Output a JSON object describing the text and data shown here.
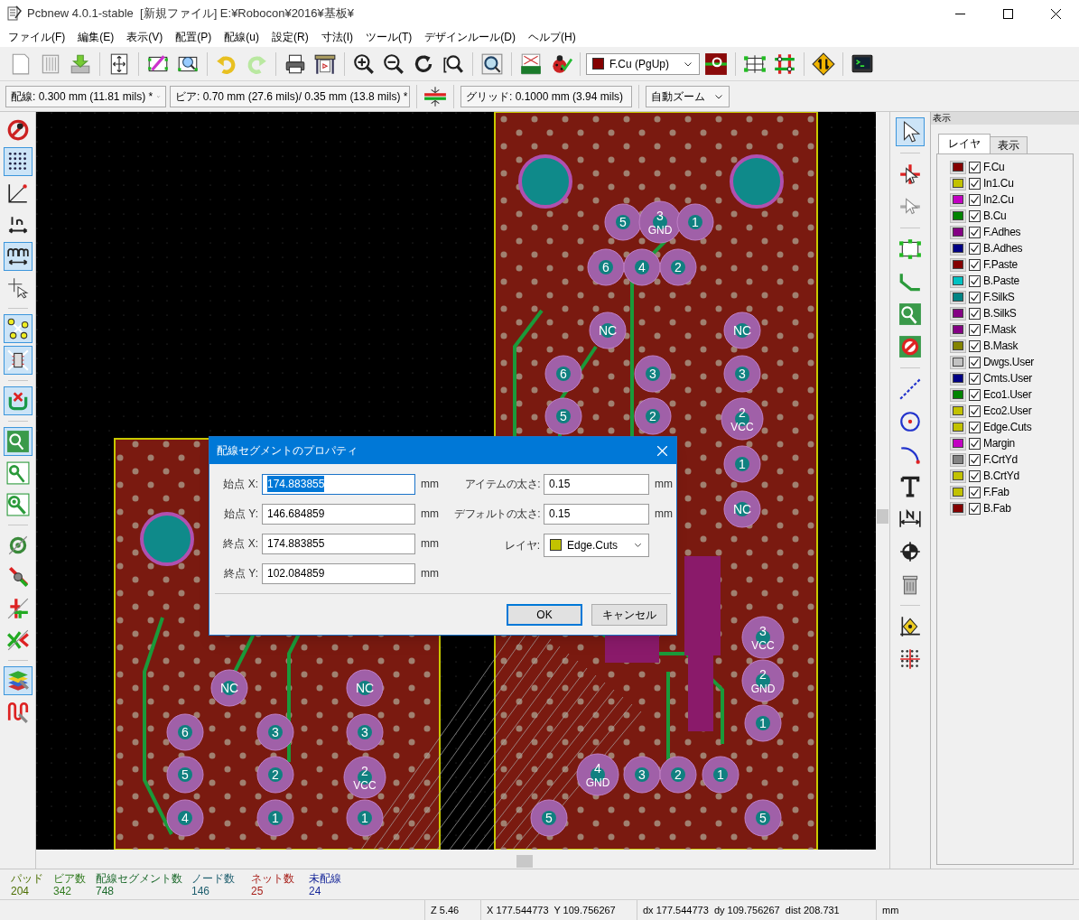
{
  "window": {
    "title": "Pcbnew 4.0.1-stable  [新規ファイル] E:¥Robocon¥2016¥基板¥"
  },
  "menu": [
    "ファイル(F)",
    "編集(E)",
    "表示(V)",
    "配置(P)",
    "配線(u)",
    "設定(R)",
    "寸法(I)",
    "ツール(T)",
    "デザインルール(D)",
    "ヘルプ(H)"
  ],
  "toolbar": {
    "layer_select": {
      "value": "F.Cu (PgUp)",
      "color": "#840000"
    }
  },
  "aux_toolbar": {
    "track_width": "配線: 0.300 mm (11.81 mils) *",
    "via_size": "ビア: 0.70 mm (27.6 mils)/ 0.35 mm (13.8 mils) *",
    "grid": "グリッド: 0.1000 mm (3.94 mils)",
    "zoom": "自動ズーム"
  },
  "left_toolbar": [
    {
      "on": false
    },
    {
      "on": true
    },
    {
      "on": false
    },
    {
      "on": false
    },
    {
      "on": true
    },
    {
      "on": false
    },
    {
      "on": true
    },
    {
      "on": true
    },
    {
      "on": true
    },
    {
      "on": true
    },
    {
      "on": false
    },
    {
      "on": false
    },
    {
      "on": false
    },
    {
      "on": false
    },
    {
      "on": false
    },
    {
      "on": false
    },
    {
      "on": true
    },
    {
      "on": false
    }
  ],
  "right_toolbar": [
    {
      "selected": true
    },
    {
      "selected": false
    },
    {
      "selected": false
    },
    {
      "selected": false
    },
    {
      "selected": false
    },
    {
      "selected": false
    },
    {
      "selected": false
    },
    {
      "selected": false
    },
    {
      "selected": false
    },
    {
      "selected": false
    },
    {
      "selected": false
    },
    {
      "selected": false
    },
    {
      "selected": false
    },
    {
      "selected": false
    },
    {
      "selected": false
    },
    {
      "selected": false
    }
  ],
  "canvas": {
    "pads": [
      {
        "number": "5"
      },
      {
        "number": "3",
        "net": "GND"
      },
      {
        "number": "1"
      },
      {
        "number": "6"
      },
      {
        "number": "4"
      },
      {
        "number": "2"
      },
      {
        "number": "NC"
      },
      {
        "number": "NC"
      },
      {
        "number": "6"
      },
      {
        "number": "3"
      },
      {
        "number": "3"
      },
      {
        "number": "5"
      },
      {
        "number": "2"
      },
      {
        "number": "2",
        "net": "VCC"
      },
      {
        "number": "1"
      },
      {
        "number": "NC"
      },
      {
        "number": "3",
        "net": "VCC"
      },
      {
        "number": "2",
        "net": "GND"
      },
      {
        "number": "1"
      },
      {
        "number": "4",
        "net": "GND"
      },
      {
        "number": "3"
      },
      {
        "number": "2"
      },
      {
        "number": "1"
      },
      {
        "number": "5"
      },
      {
        "number": "5"
      },
      {
        "number": "NC"
      },
      {
        "number": "NC"
      },
      {
        "number": "6"
      },
      {
        "number": "3"
      },
      {
        "number": "3"
      },
      {
        "number": "5"
      },
      {
        "number": "2"
      },
      {
        "number": "2",
        "net": "VCC"
      },
      {
        "number": "4"
      },
      {
        "number": "1"
      },
      {
        "number": "1"
      }
    ]
  },
  "layers_panel": {
    "title": "表示",
    "tabs": [
      {
        "label": "レイヤ",
        "selected": true
      },
      {
        "label": "表示",
        "selected": false
      }
    ],
    "layers": [
      {
        "name": "F.Cu",
        "color": "#840000",
        "checked": true
      },
      {
        "name": "In1.Cu",
        "color": "#c2c200",
        "checked": true
      },
      {
        "name": "In2.Cu",
        "color": "#c200c2",
        "checked": true
      },
      {
        "name": "B.Cu",
        "color": "#008400",
        "checked": true
      },
      {
        "name": "F.Adhes",
        "color": "#840084",
        "checked": true
      },
      {
        "name": "B.Adhes",
        "color": "#000084",
        "checked": true
      },
      {
        "name": "F.Paste",
        "color": "#840000",
        "checked": true
      },
      {
        "name": "B.Paste",
        "color": "#00c2c2",
        "checked": true
      },
      {
        "name": "F.SilkS",
        "color": "#008484",
        "checked": true
      },
      {
        "name": "B.SilkS",
        "color": "#840084",
        "checked": true
      },
      {
        "name": "F.Mask",
        "color": "#840084",
        "checked": true
      },
      {
        "name": "B.Mask",
        "color": "#848400",
        "checked": true
      },
      {
        "name": "Dwgs.User",
        "color": "#c2c2c2",
        "checked": true
      },
      {
        "name": "Cmts.User",
        "color": "#000084",
        "checked": true
      },
      {
        "name": "Eco1.User",
        "color": "#008400",
        "checked": true
      },
      {
        "name": "Eco2.User",
        "color": "#c2c200",
        "checked": true
      },
      {
        "name": "Edge.Cuts",
        "color": "#c2c200",
        "checked": true
      },
      {
        "name": "Margin",
        "color": "#c200c2",
        "checked": true
      },
      {
        "name": "F.CrtYd",
        "color": "#848484",
        "checked": true
      },
      {
        "name": "B.CrtYd",
        "color": "#c2c200",
        "checked": true
      },
      {
        "name": "F.Fab",
        "color": "#c2c200",
        "checked": true
      },
      {
        "name": "B.Fab",
        "color": "#840000",
        "checked": true
      }
    ]
  },
  "dialog": {
    "title": "配線セグメントのプロパティ",
    "left_fields": [
      {
        "label": "始点 X:",
        "value": "174.883855",
        "unit": "mm",
        "text_selected": true
      },
      {
        "label": "始点 Y:",
        "value": "146.684859",
        "unit": "mm",
        "text_selected": false
      },
      {
        "label": "終点 X:",
        "value": "174.883855",
        "unit": "mm",
        "text_selected": false
      },
      {
        "label": "終点 Y:",
        "value": "102.084859",
        "unit": "mm",
        "text_selected": false
      }
    ],
    "right_fields": [
      {
        "label": "アイテムの太さ:",
        "value": "0.15",
        "unit": "mm"
      },
      {
        "label": "デフォルトの太さ:",
        "value": "0.15",
        "unit": "mm"
      }
    ],
    "layer": {
      "label": "レイヤ:",
      "value": "Edge.Cuts",
      "color": "#c2c200"
    },
    "buttons": [
      {
        "label": "OK",
        "default": true
      },
      {
        "label": "キャンセル",
        "default": false
      }
    ]
  },
  "message_panel": [
    {
      "label": "パッド",
      "value": "204",
      "color": "#4b6e00"
    },
    {
      "label": "ビア数",
      "value": "342",
      "color": "#317b1f"
    },
    {
      "label": "配線セグメント数",
      "value": "748",
      "color": "#1d6a2d"
    },
    {
      "label": "ノード数",
      "value": "146",
      "color": "#1f5f6f"
    },
    {
      "label": "ネット数",
      "value": "25",
      "color": "#a8201a"
    },
    {
      "label": "未配線",
      "value": "24",
      "color": "#1a2a9a"
    }
  ],
  "status_bar": [
    "Z 5.46",
    "X 177.544773  Y 109.756267",
    "dx 177.544773  dy 109.756267  dist 208.731",
    "mm"
  ]
}
